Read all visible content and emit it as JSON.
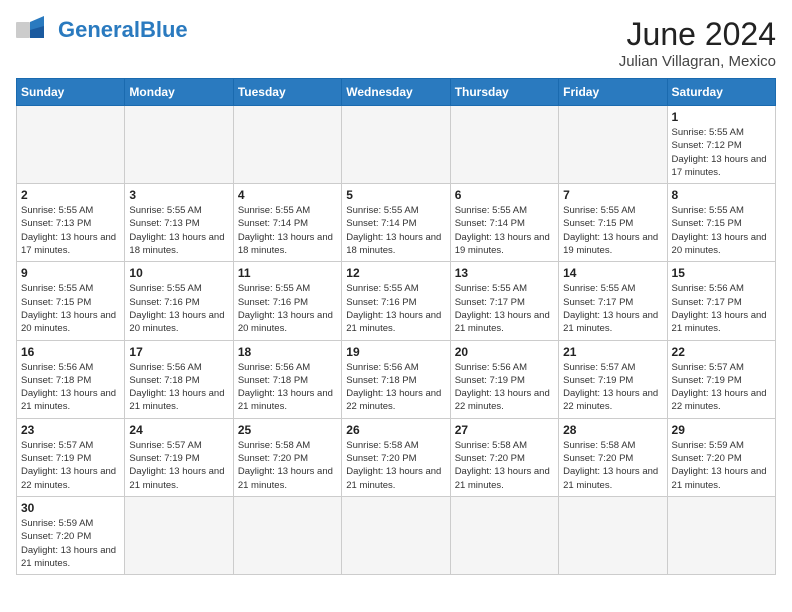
{
  "header": {
    "logo_general": "General",
    "logo_blue": "Blue",
    "title": "June 2024",
    "subtitle": "Julian Villagran, Mexico"
  },
  "weekdays": [
    "Sunday",
    "Monday",
    "Tuesday",
    "Wednesday",
    "Thursday",
    "Friday",
    "Saturday"
  ],
  "weeks": [
    [
      {
        "day": "",
        "info": ""
      },
      {
        "day": "",
        "info": ""
      },
      {
        "day": "",
        "info": ""
      },
      {
        "day": "",
        "info": ""
      },
      {
        "day": "",
        "info": ""
      },
      {
        "day": "",
        "info": ""
      },
      {
        "day": "1",
        "info": "Sunrise: 5:55 AM\nSunset: 7:12 PM\nDaylight: 13 hours and 17 minutes."
      }
    ],
    [
      {
        "day": "2",
        "info": "Sunrise: 5:55 AM\nSunset: 7:13 PM\nDaylight: 13 hours and 17 minutes."
      },
      {
        "day": "3",
        "info": "Sunrise: 5:55 AM\nSunset: 7:13 PM\nDaylight: 13 hours and 18 minutes."
      },
      {
        "day": "4",
        "info": "Sunrise: 5:55 AM\nSunset: 7:14 PM\nDaylight: 13 hours and 18 minutes."
      },
      {
        "day": "5",
        "info": "Sunrise: 5:55 AM\nSunset: 7:14 PM\nDaylight: 13 hours and 18 minutes."
      },
      {
        "day": "6",
        "info": "Sunrise: 5:55 AM\nSunset: 7:14 PM\nDaylight: 13 hours and 19 minutes."
      },
      {
        "day": "7",
        "info": "Sunrise: 5:55 AM\nSunset: 7:15 PM\nDaylight: 13 hours and 19 minutes."
      },
      {
        "day": "8",
        "info": "Sunrise: 5:55 AM\nSunset: 7:15 PM\nDaylight: 13 hours and 20 minutes."
      }
    ],
    [
      {
        "day": "9",
        "info": "Sunrise: 5:55 AM\nSunset: 7:15 PM\nDaylight: 13 hours and 20 minutes."
      },
      {
        "day": "10",
        "info": "Sunrise: 5:55 AM\nSunset: 7:16 PM\nDaylight: 13 hours and 20 minutes."
      },
      {
        "day": "11",
        "info": "Sunrise: 5:55 AM\nSunset: 7:16 PM\nDaylight: 13 hours and 20 minutes."
      },
      {
        "day": "12",
        "info": "Sunrise: 5:55 AM\nSunset: 7:16 PM\nDaylight: 13 hours and 21 minutes."
      },
      {
        "day": "13",
        "info": "Sunrise: 5:55 AM\nSunset: 7:17 PM\nDaylight: 13 hours and 21 minutes."
      },
      {
        "day": "14",
        "info": "Sunrise: 5:55 AM\nSunset: 7:17 PM\nDaylight: 13 hours and 21 minutes."
      },
      {
        "day": "15",
        "info": "Sunrise: 5:56 AM\nSunset: 7:17 PM\nDaylight: 13 hours and 21 minutes."
      }
    ],
    [
      {
        "day": "16",
        "info": "Sunrise: 5:56 AM\nSunset: 7:18 PM\nDaylight: 13 hours and 21 minutes."
      },
      {
        "day": "17",
        "info": "Sunrise: 5:56 AM\nSunset: 7:18 PM\nDaylight: 13 hours and 21 minutes."
      },
      {
        "day": "18",
        "info": "Sunrise: 5:56 AM\nSunset: 7:18 PM\nDaylight: 13 hours and 21 minutes."
      },
      {
        "day": "19",
        "info": "Sunrise: 5:56 AM\nSunset: 7:18 PM\nDaylight: 13 hours and 22 minutes."
      },
      {
        "day": "20",
        "info": "Sunrise: 5:56 AM\nSunset: 7:19 PM\nDaylight: 13 hours and 22 minutes."
      },
      {
        "day": "21",
        "info": "Sunrise: 5:57 AM\nSunset: 7:19 PM\nDaylight: 13 hours and 22 minutes."
      },
      {
        "day": "22",
        "info": "Sunrise: 5:57 AM\nSunset: 7:19 PM\nDaylight: 13 hours and 22 minutes."
      }
    ],
    [
      {
        "day": "23",
        "info": "Sunrise: 5:57 AM\nSunset: 7:19 PM\nDaylight: 13 hours and 22 minutes."
      },
      {
        "day": "24",
        "info": "Sunrise: 5:57 AM\nSunset: 7:19 PM\nDaylight: 13 hours and 21 minutes."
      },
      {
        "day": "25",
        "info": "Sunrise: 5:58 AM\nSunset: 7:20 PM\nDaylight: 13 hours and 21 minutes."
      },
      {
        "day": "26",
        "info": "Sunrise: 5:58 AM\nSunset: 7:20 PM\nDaylight: 13 hours and 21 minutes."
      },
      {
        "day": "27",
        "info": "Sunrise: 5:58 AM\nSunset: 7:20 PM\nDaylight: 13 hours and 21 minutes."
      },
      {
        "day": "28",
        "info": "Sunrise: 5:58 AM\nSunset: 7:20 PM\nDaylight: 13 hours and 21 minutes."
      },
      {
        "day": "29",
        "info": "Sunrise: 5:59 AM\nSunset: 7:20 PM\nDaylight: 13 hours and 21 minutes."
      }
    ],
    [
      {
        "day": "30",
        "info": "Sunrise: 5:59 AM\nSunset: 7:20 PM\nDaylight: 13 hours and 21 minutes."
      },
      {
        "day": "",
        "info": ""
      },
      {
        "day": "",
        "info": ""
      },
      {
        "day": "",
        "info": ""
      },
      {
        "day": "",
        "info": ""
      },
      {
        "day": "",
        "info": ""
      },
      {
        "day": "",
        "info": ""
      }
    ]
  ]
}
